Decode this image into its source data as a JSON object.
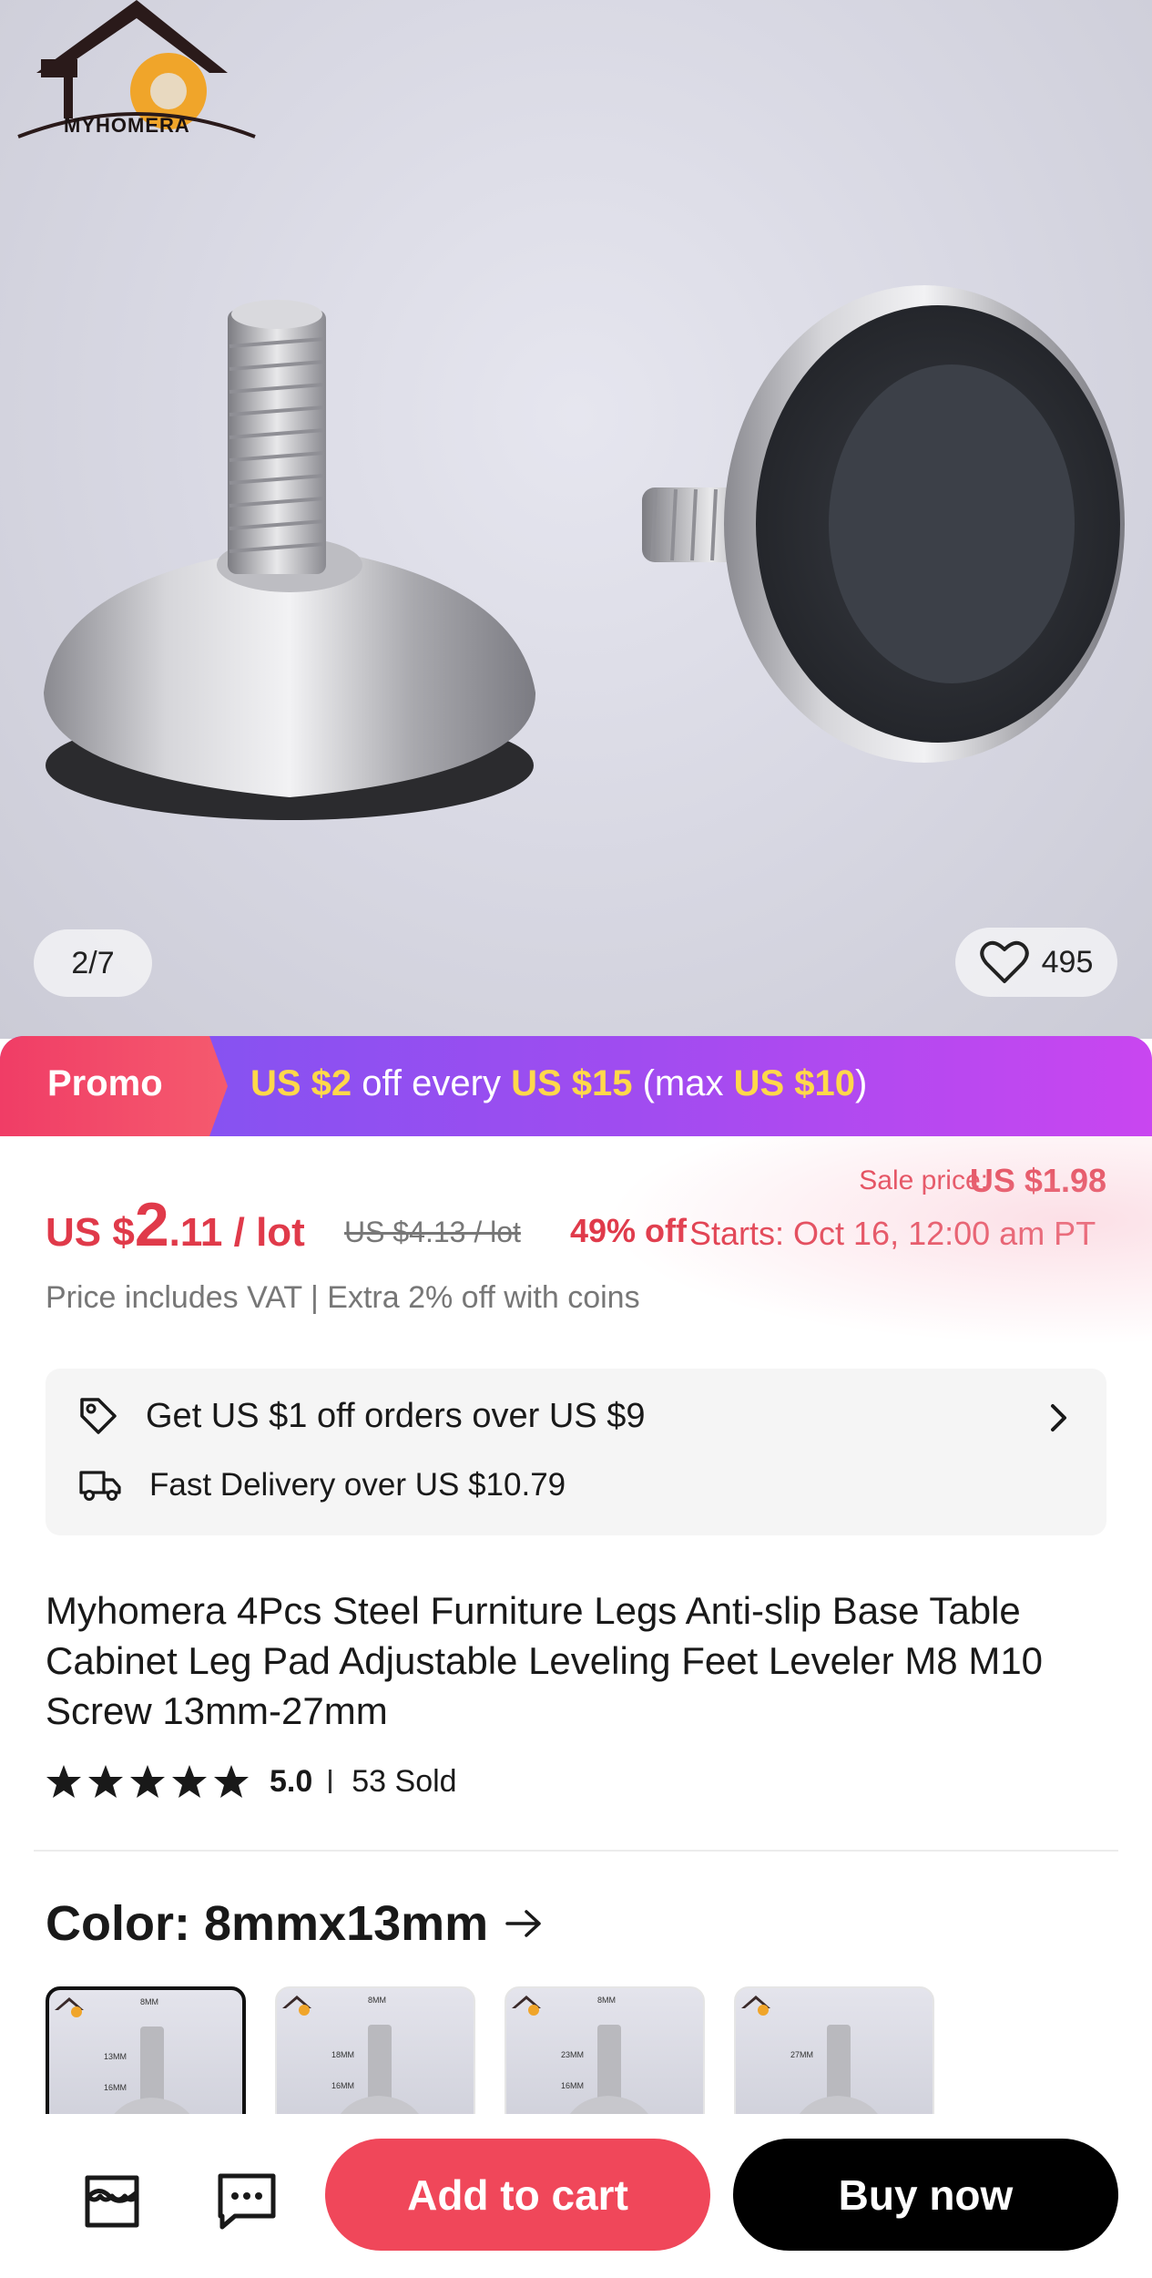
{
  "gallery": {
    "brand_logo_text": "MYHOMERA",
    "counter": "2/7",
    "wishlist_count": "495"
  },
  "promo": {
    "tag": "Promo",
    "amount": "US $2",
    "text_1": " off every ",
    "threshold": "US $15",
    "text_2": " (max ",
    "max": "US $10",
    "text_3": ")"
  },
  "price": {
    "sale_label": "Sale price:",
    "sale_price": "US $1.98",
    "currency": "US $",
    "whole": "2",
    "fraction_unit": ".11 / lot",
    "original": "US $4.13 / lot",
    "discount": "49% off",
    "starts": "Starts:  Oct 16, 12:00 am PT",
    "vat_note": "Price includes VAT | Extra 2% off with coins"
  },
  "coupons": {
    "offer": "Get US $1 off orders over US $9",
    "delivery": "Fast Delivery over US $10.79"
  },
  "product": {
    "title": "Myhomera 4Pcs Steel Furniture Legs Anti-slip Base Table Cabinet Leg Pad Adjustable Leveling Feet Leveler M8 M10 Screw 13mm-27mm",
    "rating": "5.0",
    "stars": 5,
    "sold": "53 Sold"
  },
  "color": {
    "label": "Color: 8mmx13mm",
    "options": [
      {
        "top_label": "8MM",
        "side_label": "13MM",
        "bottom_label": "16MM"
      },
      {
        "top_label": "8MM",
        "side_label": "18MM",
        "bottom_label": "16MM"
      },
      {
        "top_label": "8MM",
        "side_label": "23MM",
        "bottom_label": "16MM"
      },
      {
        "top_label": "",
        "side_label": "27MM",
        "bottom_label": ""
      }
    ]
  },
  "actions": {
    "add_to_cart": "Add to cart",
    "buy_now": "Buy now"
  },
  "colors": {
    "accent_red": "#f0475a",
    "price_red": "#e03a4a",
    "promo_yellow": "#ffd84a",
    "promo_purple": "#a04cf0"
  }
}
